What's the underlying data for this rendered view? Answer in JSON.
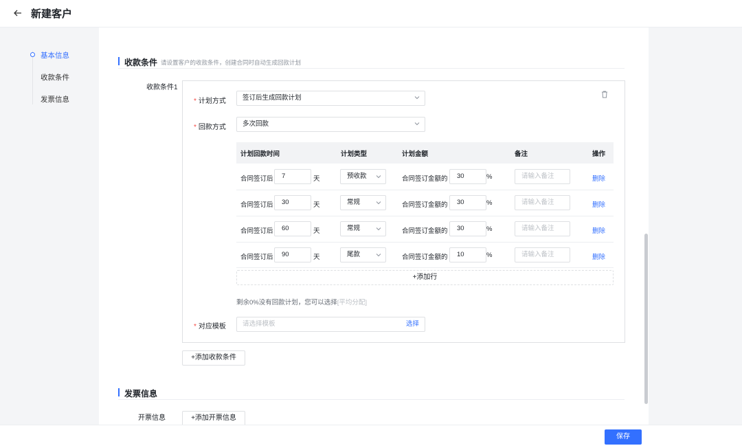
{
  "header": {
    "title": "新建客户"
  },
  "sidebar": {
    "items": [
      {
        "label": "基本信息"
      },
      {
        "label": "收款条件"
      },
      {
        "label": "发票信息"
      }
    ]
  },
  "payment": {
    "section_title": "收款条件",
    "section_subtitle": "请设置客户的收款条件，创建合同时自动生成回款计划",
    "condition_label": "收款条件1",
    "plan_method": {
      "label": "计划方式",
      "value": "签订后生成回款计划"
    },
    "return_method": {
      "label": "回款方式",
      "value": "多次回款"
    },
    "table": {
      "headers": [
        "计划回款时间",
        "计划类型",
        "计划金额",
        "备注",
        "操作"
      ],
      "rows": [
        {
          "prefix": "合同签订后",
          "days": "7",
          "unit": "天",
          "type": "预收款",
          "amount_prefix": "合同签订金额的",
          "percent": "30",
          "percent_sign": "%",
          "note_placeholder": "请输入备注",
          "action": "删除"
        },
        {
          "prefix": "合同签订后",
          "days": "30",
          "unit": "天",
          "type": "常规",
          "amount_prefix": "合同签订金额的",
          "percent": "30",
          "percent_sign": "%",
          "note_placeholder": "请输入备注",
          "action": "删除"
        },
        {
          "prefix": "合同签订后",
          "days": "60",
          "unit": "天",
          "type": "常规",
          "amount_prefix": "合同签订金额的",
          "percent": "30",
          "percent_sign": "%",
          "note_placeholder": "请输入备注",
          "action": "删除"
        },
        {
          "prefix": "合同签订后",
          "days": "90",
          "unit": "天",
          "type": "尾款",
          "amount_prefix": "合同签订金额的",
          "percent": "10",
          "percent_sign": "%",
          "note_placeholder": "请输入备注",
          "action": "删除"
        }
      ],
      "add_row_label": "+添加行"
    },
    "remain_text": "剩余0%没有回款计划，您可以选择",
    "remain_link": "[平均分配]",
    "template": {
      "label": "对应模板",
      "placeholder": "请选择模板",
      "choose_label": "选择"
    },
    "add_condition_label": "+添加收款条件"
  },
  "invoice": {
    "section_title": "发票信息",
    "label": "开票信息",
    "add_label": "+添加开票信息"
  },
  "footer": {
    "save_label": "保存"
  },
  "colors": {
    "accent": "#3370ff",
    "required": "#f54a45"
  },
  "icons": {
    "back": "arrow-left-icon",
    "delete": "trash-icon",
    "dropdown": "chevron-down-icon"
  }
}
